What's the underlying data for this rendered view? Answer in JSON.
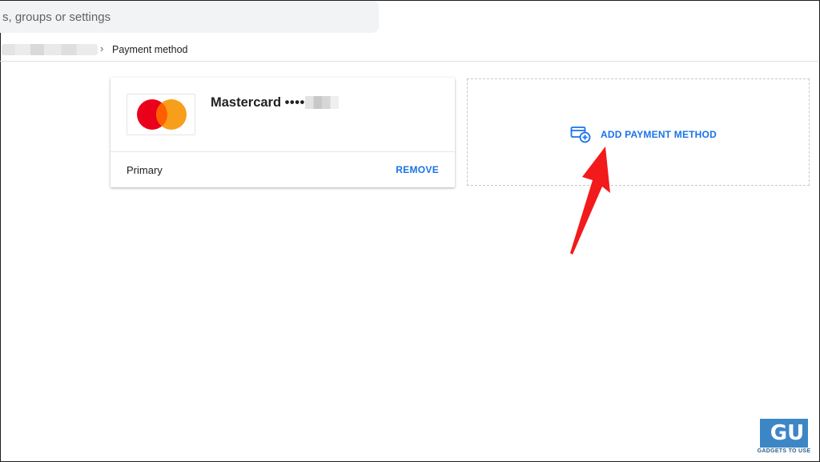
{
  "search": {
    "placeholder_text": "s, groups or settings"
  },
  "breadcrumb": {
    "separator": "›",
    "current": "Payment method"
  },
  "payment_card": {
    "brand": "Mastercard",
    "masked_number": "••••",
    "status": "Primary",
    "remove_label": "REMOVE",
    "logo_colors": {
      "left": "#eb001b",
      "right": "#f79e1b",
      "overlap": "#ff5f00"
    }
  },
  "add_payment": {
    "label": "ADD PAYMENT METHOD",
    "icon": "add-card-icon"
  },
  "annotation": {
    "arrow_color": "#f21a1a"
  },
  "watermark": {
    "glyph": "GU",
    "text": "GADGETS TO USE"
  },
  "colors": {
    "accent": "#1a73e8"
  }
}
